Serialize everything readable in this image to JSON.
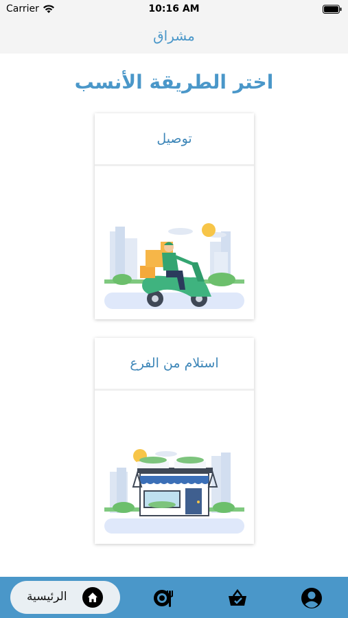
{
  "status_bar": {
    "carrier": "Carrier",
    "time": "10:16 AM"
  },
  "nav": {
    "title": "مشراق"
  },
  "heading": "اختر الطريقة الأنسب",
  "options": {
    "delivery": {
      "label": "توصيل",
      "image_icon": "delivery-scooter-illustration"
    },
    "pickup": {
      "label": "استلام من الفرع",
      "image_icon": "storefront-illustration"
    }
  },
  "tabbar": {
    "home_label": "الرئيسية",
    "icons": [
      "home-icon",
      "restaurant-icon",
      "basket-check-icon",
      "profile-icon"
    ]
  },
  "colors": {
    "accent": "#4a97c9",
    "tabbar": "#4a97c9",
    "home_pill": "#e9eff3"
  }
}
